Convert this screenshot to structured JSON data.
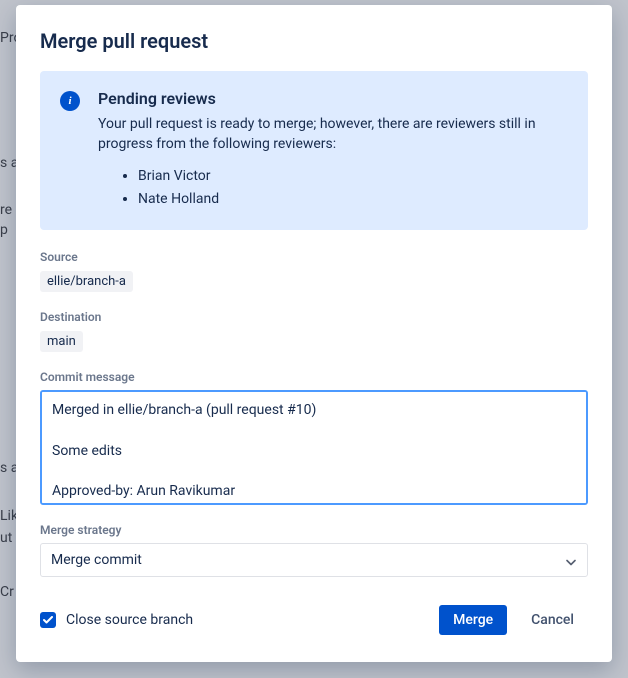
{
  "modal": {
    "title": "Merge pull request",
    "info": {
      "title": "Pending reviews",
      "description": "Your pull request is ready to merge; however, there are reviewers still in progress from the following reviewers:",
      "reviewers": [
        "Brian Victor",
        "Nate Holland"
      ]
    },
    "source_label": "Source",
    "source_value": "ellie/branch-a",
    "destination_label": "Destination",
    "destination_value": "main",
    "commit_label": "Commit message",
    "commit_value": "Merged in ellie/branch-a (pull request #10)\n\nSome edits\n\nApproved-by: Arun Ravikumar",
    "strategy_label": "Merge strategy",
    "strategy_value": "Merge commit",
    "close_branch_label": "Close source branch",
    "close_branch_checked": true,
    "merge_button": "Merge",
    "cancel_button": "Cancel"
  }
}
